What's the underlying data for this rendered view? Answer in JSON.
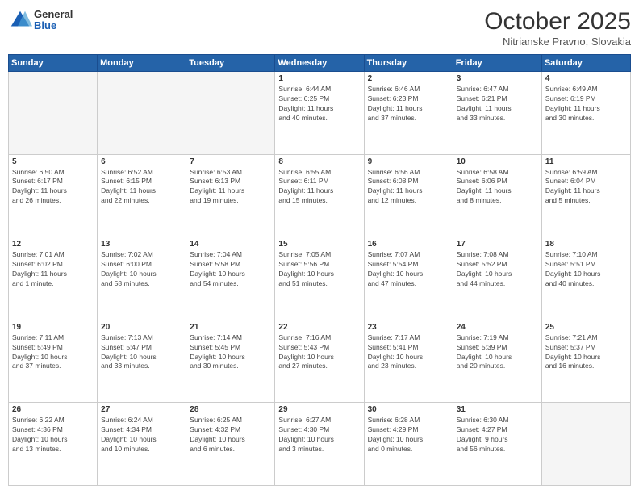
{
  "logo": {
    "general": "General",
    "blue": "Blue"
  },
  "header": {
    "month": "October 2025",
    "location": "Nitrianske Pravno, Slovakia"
  },
  "weekdays": [
    "Sunday",
    "Monday",
    "Tuesday",
    "Wednesday",
    "Thursday",
    "Friday",
    "Saturday"
  ],
  "weeks": [
    [
      {
        "day": "",
        "info": ""
      },
      {
        "day": "",
        "info": ""
      },
      {
        "day": "",
        "info": ""
      },
      {
        "day": "1",
        "info": "Sunrise: 6:44 AM\nSunset: 6:25 PM\nDaylight: 11 hours\nand 40 minutes."
      },
      {
        "day": "2",
        "info": "Sunrise: 6:46 AM\nSunset: 6:23 PM\nDaylight: 11 hours\nand 37 minutes."
      },
      {
        "day": "3",
        "info": "Sunrise: 6:47 AM\nSunset: 6:21 PM\nDaylight: 11 hours\nand 33 minutes."
      },
      {
        "day": "4",
        "info": "Sunrise: 6:49 AM\nSunset: 6:19 PM\nDaylight: 11 hours\nand 30 minutes."
      }
    ],
    [
      {
        "day": "5",
        "info": "Sunrise: 6:50 AM\nSunset: 6:17 PM\nDaylight: 11 hours\nand 26 minutes."
      },
      {
        "day": "6",
        "info": "Sunrise: 6:52 AM\nSunset: 6:15 PM\nDaylight: 11 hours\nand 22 minutes."
      },
      {
        "day": "7",
        "info": "Sunrise: 6:53 AM\nSunset: 6:13 PM\nDaylight: 11 hours\nand 19 minutes."
      },
      {
        "day": "8",
        "info": "Sunrise: 6:55 AM\nSunset: 6:11 PM\nDaylight: 11 hours\nand 15 minutes."
      },
      {
        "day": "9",
        "info": "Sunrise: 6:56 AM\nSunset: 6:08 PM\nDaylight: 11 hours\nand 12 minutes."
      },
      {
        "day": "10",
        "info": "Sunrise: 6:58 AM\nSunset: 6:06 PM\nDaylight: 11 hours\nand 8 minutes."
      },
      {
        "day": "11",
        "info": "Sunrise: 6:59 AM\nSunset: 6:04 PM\nDaylight: 11 hours\nand 5 minutes."
      }
    ],
    [
      {
        "day": "12",
        "info": "Sunrise: 7:01 AM\nSunset: 6:02 PM\nDaylight: 11 hours\nand 1 minute."
      },
      {
        "day": "13",
        "info": "Sunrise: 7:02 AM\nSunset: 6:00 PM\nDaylight: 10 hours\nand 58 minutes."
      },
      {
        "day": "14",
        "info": "Sunrise: 7:04 AM\nSunset: 5:58 PM\nDaylight: 10 hours\nand 54 minutes."
      },
      {
        "day": "15",
        "info": "Sunrise: 7:05 AM\nSunset: 5:56 PM\nDaylight: 10 hours\nand 51 minutes."
      },
      {
        "day": "16",
        "info": "Sunrise: 7:07 AM\nSunset: 5:54 PM\nDaylight: 10 hours\nand 47 minutes."
      },
      {
        "day": "17",
        "info": "Sunrise: 7:08 AM\nSunset: 5:52 PM\nDaylight: 10 hours\nand 44 minutes."
      },
      {
        "day": "18",
        "info": "Sunrise: 7:10 AM\nSunset: 5:51 PM\nDaylight: 10 hours\nand 40 minutes."
      }
    ],
    [
      {
        "day": "19",
        "info": "Sunrise: 7:11 AM\nSunset: 5:49 PM\nDaylight: 10 hours\nand 37 minutes."
      },
      {
        "day": "20",
        "info": "Sunrise: 7:13 AM\nSunset: 5:47 PM\nDaylight: 10 hours\nand 33 minutes."
      },
      {
        "day": "21",
        "info": "Sunrise: 7:14 AM\nSunset: 5:45 PM\nDaylight: 10 hours\nand 30 minutes."
      },
      {
        "day": "22",
        "info": "Sunrise: 7:16 AM\nSunset: 5:43 PM\nDaylight: 10 hours\nand 27 minutes."
      },
      {
        "day": "23",
        "info": "Sunrise: 7:17 AM\nSunset: 5:41 PM\nDaylight: 10 hours\nand 23 minutes."
      },
      {
        "day": "24",
        "info": "Sunrise: 7:19 AM\nSunset: 5:39 PM\nDaylight: 10 hours\nand 20 minutes."
      },
      {
        "day": "25",
        "info": "Sunrise: 7:21 AM\nSunset: 5:37 PM\nDaylight: 10 hours\nand 16 minutes."
      }
    ],
    [
      {
        "day": "26",
        "info": "Sunrise: 6:22 AM\nSunset: 4:36 PM\nDaylight: 10 hours\nand 13 minutes."
      },
      {
        "day": "27",
        "info": "Sunrise: 6:24 AM\nSunset: 4:34 PM\nDaylight: 10 hours\nand 10 minutes."
      },
      {
        "day": "28",
        "info": "Sunrise: 6:25 AM\nSunset: 4:32 PM\nDaylight: 10 hours\nand 6 minutes."
      },
      {
        "day": "29",
        "info": "Sunrise: 6:27 AM\nSunset: 4:30 PM\nDaylight: 10 hours\nand 3 minutes."
      },
      {
        "day": "30",
        "info": "Sunrise: 6:28 AM\nSunset: 4:29 PM\nDaylight: 10 hours\nand 0 minutes."
      },
      {
        "day": "31",
        "info": "Sunrise: 6:30 AM\nSunset: 4:27 PM\nDaylight: 9 hours\nand 56 minutes."
      },
      {
        "day": "",
        "info": ""
      }
    ]
  ]
}
